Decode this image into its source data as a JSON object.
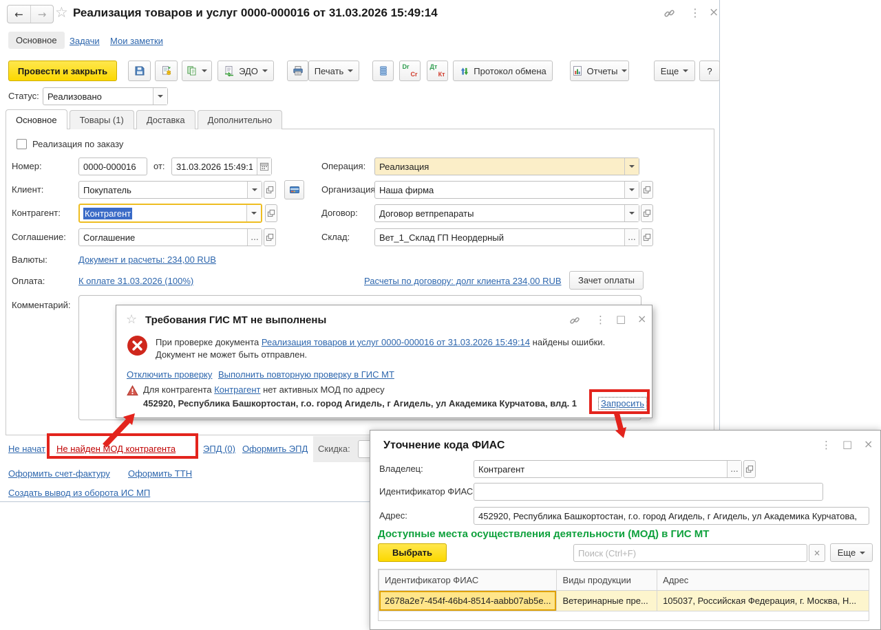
{
  "colors": {
    "accent_yellow": "#FFDE00",
    "link_blue": "#2D66AD",
    "error_red": "#CF271C",
    "annotation_red": "#E3241D",
    "section_green": "#0EA13C",
    "focus_gold": "#EEBD20",
    "selection_blue": "#3B6BC7",
    "field_required_cream": "#FBEEC8",
    "table_selected_yellow": "#FFE58A"
  },
  "icons": {
    "back": "←",
    "forward": "→",
    "star": "☆",
    "kebab": "⋮",
    "close": "×",
    "maximize": "□",
    "ellipsis": "...",
    "clear": "×"
  },
  "window": {
    "title": "Реализация товаров и услуг 0000-000016 от 31.03.2026 15:49:14",
    "nav_tabs": {
      "main": "Основное",
      "tasks": "Задачи",
      "notes": "Мои заметки"
    }
  },
  "toolbar": {
    "post_and_close": "Провести и закрыть",
    "edo": "ЭДО",
    "print": "Печать",
    "dr": "Dr",
    "cr": "Cr",
    "dt": "Дт",
    "kt": "Кт",
    "protocol": "Протокол обмена",
    "reports": "Отчеты",
    "more": "Еще",
    "help": "?"
  },
  "status": {
    "label": "Статус:",
    "value": "Реализовано"
  },
  "doc_tabs": {
    "main": "Основное",
    "goods": "Товары (1)",
    "delivery": "Доставка",
    "additional": "Дополнительно"
  },
  "form": {
    "order_checkbox": "Реализация по заказу",
    "number": {
      "label": "Номер:",
      "value": "0000-000016"
    },
    "date": {
      "label": "от:",
      "value": "31.03.2026 15:49:14"
    },
    "operation": {
      "label": "Операция:",
      "value": "Реализация"
    },
    "client": {
      "label": "Клиент:",
      "value": "Покупатель"
    },
    "organization": {
      "label": "Организация:",
      "value": "Наша фирма"
    },
    "counterparty": {
      "label": "Контрагент:",
      "value": "Контрагент"
    },
    "contract": {
      "label": "Договор:",
      "value": "Договор ветпрепараты"
    },
    "agreement": {
      "label": "Соглашение:",
      "value": "Соглашение"
    },
    "warehouse": {
      "label": "Склад:",
      "value": "Вет_1_Склад ГП Неордерный"
    },
    "currencies": {
      "label": "Валюты:",
      "link": "Документ и расчеты: 234,00 RUB"
    },
    "payment": {
      "label": "Оплата:",
      "link": "К оплате 31.03.2026 (100%)"
    },
    "settlements_link": "Расчеты по договору: долг клиента 234,00 RUB",
    "offset_button": "Зачет оплаты",
    "comment_label": "Комментарий:"
  },
  "footer": {
    "not_started": "Не начат",
    "mod_not_found": "Не найден МОД контрагента",
    "epd": "ЭПД (0)",
    "epd_create": "Оформить ЭПД",
    "discount_label": "Скидка:",
    "invoice": "Оформить счет-фактуру",
    "ttn": "Оформить ТТН",
    "withdrawal": "Создать вывод из оборота ИС МП"
  },
  "dialog": {
    "title": "Требования ГИС МТ не выполнены",
    "error_prefix": "При проверке документа",
    "error_link": "Реализация товаров и услуг 0000-000016 от 31.03.2026 15:49:14",
    "error_suffix": "найдены ошибки.",
    "error_line2": "Документ не может быть отправлен.",
    "disable_check": "Отключить проверку",
    "recheck": "Выполнить повторную проверку в ГИС МТ",
    "warning_prefix": "Для контрагента",
    "warning_link": "Контрагент",
    "warning_suffix": "нет активных МОД по адресу",
    "warning_address": "452920, Республика Башкортостан, г.о. город Агидель, г Агидель, ул Академика Курчатова, влд. 1",
    "request_link": "Запросить"
  },
  "fias": {
    "title": "Уточнение кода ФИАС",
    "owner": {
      "label": "Владелец:",
      "value": "Контрагент"
    },
    "fias_id": {
      "label": "Идентификатор ФИАС:",
      "value": ""
    },
    "address": {
      "label": "Адрес:",
      "value": "452920, Республика Башкортостан, г.о. город Агидель, г Агидель, ул Академика Курчатова,"
    },
    "section_title": "Доступные места осуществления деятельности (МОД) в ГИС МТ",
    "select_button": "Выбрать",
    "search_placeholder": "Поиск (Ctrl+F)",
    "more": "Еще",
    "table": {
      "headers": [
        "Идентификатор ФИАС",
        "Виды продукции",
        "Адрес"
      ],
      "rows": [
        [
          "2678a2e7-454f-46b4-8514-aabb07ab5e...",
          "Ветеринарные пре...",
          "105037, Российская Федерация, г. Москва, Н..."
        ]
      ]
    }
  }
}
